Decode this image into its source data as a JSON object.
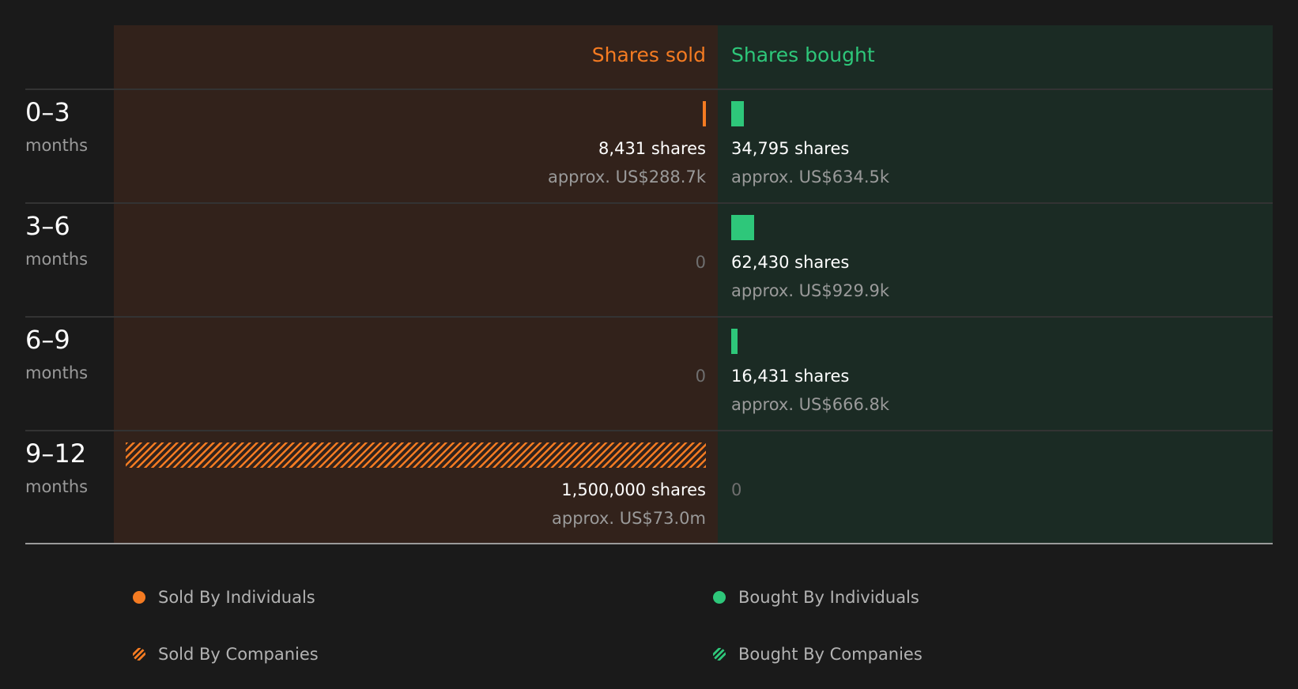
{
  "chart_data": {
    "type": "bar",
    "title": "",
    "headers": {
      "sold": "Shares sold",
      "bought": "Shares bought"
    },
    "colors": {
      "sold": "#f47b22",
      "bought": "#2ec77a",
      "sold_bg": "#32221b",
      "bought_bg": "#1b2b24"
    },
    "periods": [
      {
        "label": "0–3",
        "unit": "months",
        "sold": {
          "shares": 8431,
          "company": false,
          "shares_text": "8,431 shares",
          "value_text": "approx. US$288.7k"
        },
        "bought": {
          "shares": 34795,
          "company": false,
          "shares_text": "34,795 shares",
          "value_text": "approx. US$634.5k"
        }
      },
      {
        "label": "3–6",
        "unit": "months",
        "sold": {
          "shares": 0,
          "zero_text": "0"
        },
        "bought": {
          "shares": 62430,
          "company": false,
          "shares_text": "62,430 shares",
          "value_text": "approx. US$929.9k"
        }
      },
      {
        "label": "6–9",
        "unit": "months",
        "sold": {
          "shares": 0,
          "zero_text": "0"
        },
        "bought": {
          "shares": 16431,
          "company": false,
          "shares_text": "16,431 shares",
          "value_text": "approx. US$666.8k"
        }
      },
      {
        "label": "9–12",
        "unit": "months",
        "sold": {
          "shares": 1500000,
          "company": true,
          "shares_text": "1,500,000 shares",
          "value_text": "approx. US$73.0m"
        },
        "bought": {
          "shares": 0,
          "zero_text": "0"
        }
      }
    ],
    "legend": [
      {
        "label": "Sold By Individuals",
        "side": "sold",
        "pattern": "solid"
      },
      {
        "label": "Bought By Individuals",
        "side": "bought",
        "pattern": "solid"
      },
      {
        "label": "Sold By Companies",
        "side": "sold",
        "pattern": "hatched"
      },
      {
        "label": "Bought By Companies",
        "side": "bought",
        "pattern": "hatched"
      }
    ]
  }
}
